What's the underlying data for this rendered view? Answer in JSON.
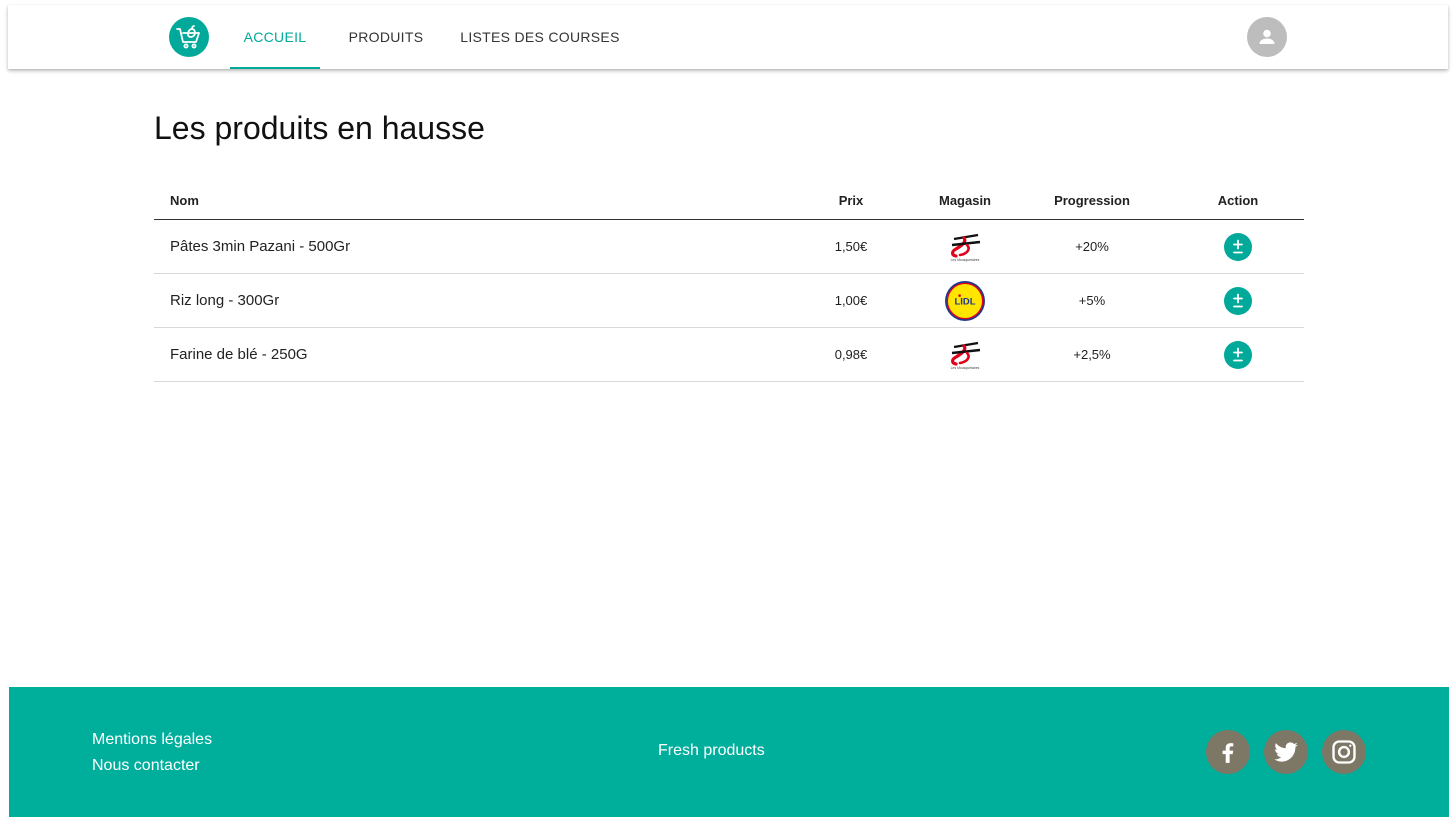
{
  "nav": {
    "tabs": [
      {
        "label": "ACCUEIL",
        "active": true
      },
      {
        "label": "PRODUITS",
        "active": false
      },
      {
        "label": "LISTES DES COURSES",
        "active": false
      }
    ]
  },
  "main": {
    "title": "Les produits en hausse",
    "table": {
      "headers": [
        "Nom",
        "Prix",
        "Magasin",
        "Progression",
        "Action"
      ],
      "rows": [
        {
          "name": "Pâtes 3min Pazani - 500Gr",
          "price": "1,50€",
          "store": "intermarche-logo",
          "progression": "+20%"
        },
        {
          "name": "Riz long - 300Gr",
          "price": "1,00€",
          "store": "lidl-logo",
          "progression": "+5%"
        },
        {
          "name": "Farine de blé - 250G",
          "price": "0,98€",
          "store": "intermarche-logo",
          "progression": "+2,5%"
        }
      ],
      "lidl_logo_text": "LIDL",
      "intermarche_logo_text": "Les Mousquetaires"
    }
  },
  "footer": {
    "links": [
      "Mentions légales",
      "Nous contacter"
    ],
    "tagline": "Fresh products",
    "social": [
      "facebook-icon",
      "twitter-icon",
      "instagram-icon"
    ]
  },
  "colors": {
    "accent": "#00a99a",
    "footer_bg": "#00ae9c",
    "social_bg": "#7d7766",
    "avatar_bg": "#bdbdbd"
  }
}
